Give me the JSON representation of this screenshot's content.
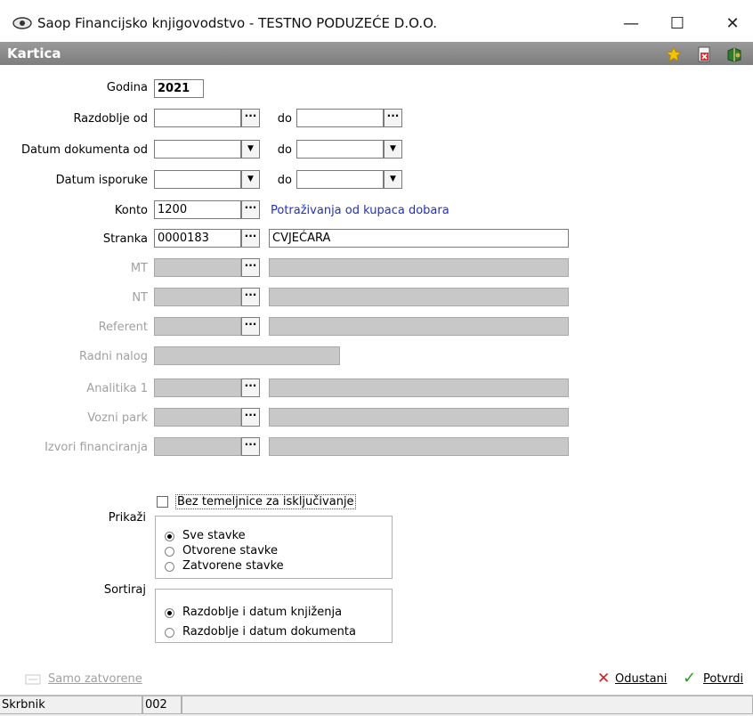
{
  "window": {
    "title": "Saop Financijsko knjigovodstvo - TESTNO PODUZEĆE D.O.O.",
    "minimize_glyph": "—",
    "maximize_glyph": "☐",
    "close_glyph": "✕"
  },
  "header": {
    "title": "Kartica",
    "icons": [
      "favorite-star-icon",
      "delete-report-icon",
      "exit-book-icon"
    ]
  },
  "form": {
    "godina": {
      "label": "Godina",
      "value": "2021"
    },
    "razdoblje": {
      "label": "Razdoblje od",
      "to_label": "do",
      "from": "",
      "to": "",
      "button": "···"
    },
    "datum_dokumenta": {
      "label": "Datum dokumenta od",
      "to_label": "do",
      "from": "",
      "to": ""
    },
    "datum_isporuke": {
      "label": "Datum isporuke",
      "to_label": "do",
      "from": "",
      "to": ""
    },
    "konto": {
      "label": "Konto",
      "value": "1200",
      "description": "Potraživanja od kupaca dobara"
    },
    "stranka": {
      "label": "Stranka",
      "value": "0000183",
      "name": "CVJEĆARA"
    },
    "mt": {
      "label": "MT",
      "value": "",
      "name": ""
    },
    "nt": {
      "label": "NT",
      "value": "",
      "name": ""
    },
    "referent": {
      "label": "Referent",
      "value": "",
      "name": ""
    },
    "radni_nalog": {
      "label": "Radni nalog",
      "value": ""
    },
    "analitika1": {
      "label": "Analitika 1",
      "value": "",
      "name": ""
    },
    "vozni_park": {
      "label": "Vozni park",
      "value": "",
      "name": ""
    },
    "izvori": {
      "label": "Izvori financiranja",
      "value": "",
      "name": ""
    },
    "dots": "···",
    "arrow": "▼"
  },
  "options": {
    "bez_temeljnice": {
      "label": "Bez temeljnice za isključivanje",
      "checked": false
    },
    "prikazi": {
      "label": "Prikaži",
      "items": [
        "Sve stavke",
        "Otvorene stavke",
        "Zatvorene stavke"
      ],
      "selected": 0
    },
    "sortiraj": {
      "label": "Sortiraj",
      "items": [
        "Razdoblje i datum knjiženja",
        "Razdoblje i datum dokumenta"
      ],
      "selected": 0
    }
  },
  "footer": {
    "samo_zatvorene": "Samo zatvorene",
    "cancel": "Odustani",
    "confirm": "Potvrdi",
    "cancel_glyph": "✕",
    "confirm_glyph": "✓"
  },
  "status": {
    "label": "Skrbnik",
    "code": "002"
  },
  "colors": {
    "header_band": "#8a8a8a",
    "link_blue": "#2030c8",
    "disabled_field": "#c8c8c8",
    "cancel_red": "#d02020",
    "confirm_green": "#2a9a2a"
  }
}
